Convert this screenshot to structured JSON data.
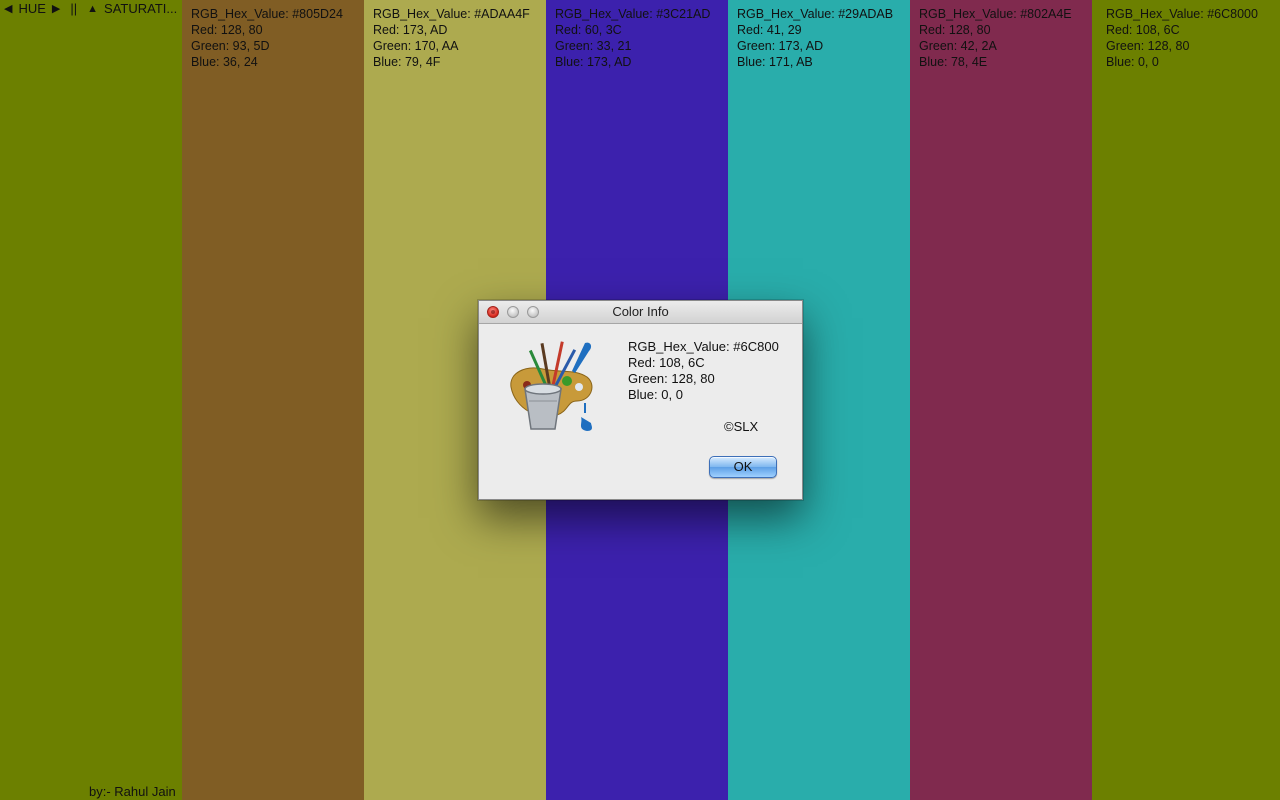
{
  "toolbar": {
    "hue_label": "HUE",
    "separator": "||",
    "saturation_label": "SATURATI..."
  },
  "credit": "by:- Rahul Jain",
  "strips": [
    {
      "color": "#6C8000",
      "hex_line": "",
      "red_line": "",
      "green_line": "",
      "blue_line": ""
    },
    {
      "color": "#805D24",
      "hex_line": "RGB_Hex_Value: #805D24",
      "red_line": "Red: 128, 80",
      "green_line": "Green: 93, 5D",
      "blue_line": "Blue: 36, 24"
    },
    {
      "color": "#ADAA4F",
      "hex_line": "RGB_Hex_Value: #ADAA4F",
      "red_line": "Red: 173, AD",
      "green_line": "Green: 170, AA",
      "blue_line": "Blue: 79, 4F"
    },
    {
      "color": "#3C21AD",
      "hex_line": "RGB_Hex_Value: #3C21AD",
      "red_line": "Red: 60, 3C",
      "green_line": "Green: 33, 21",
      "blue_line": "Blue: 173, AD"
    },
    {
      "color": "#29ADAB",
      "hex_line": "RGB_Hex_Value: #29ADAB",
      "red_line": "Red: 41, 29",
      "green_line": "Green: 173, AD",
      "blue_line": "Blue: 171, AB"
    },
    {
      "color": "#802A4E",
      "hex_line": "RGB_Hex_Value: #802A4E",
      "red_line": "Red: 128, 80",
      "green_line": "Green: 42, 2A",
      "blue_line": "Blue: 78, 4E"
    },
    {
      "color": "#6C8000",
      "hex_line": "RGB_Hex_Value: #6C8000",
      "red_line": "Red: 108, 6C",
      "green_line": "Green: 128, 80",
      "blue_line": "Blue: 0, 0"
    }
  ],
  "dialog": {
    "title": "Color Info",
    "hex_line": "RGB_Hex_Value: #6C800",
    "red_line": "Red: 108, 6C",
    "green_line": "Green: 128, 80",
    "blue_line": "Blue: 0, 0",
    "copyright": "©SLX",
    "ok_label": "OK",
    "icon": "paint-bucket-palette-icon"
  }
}
